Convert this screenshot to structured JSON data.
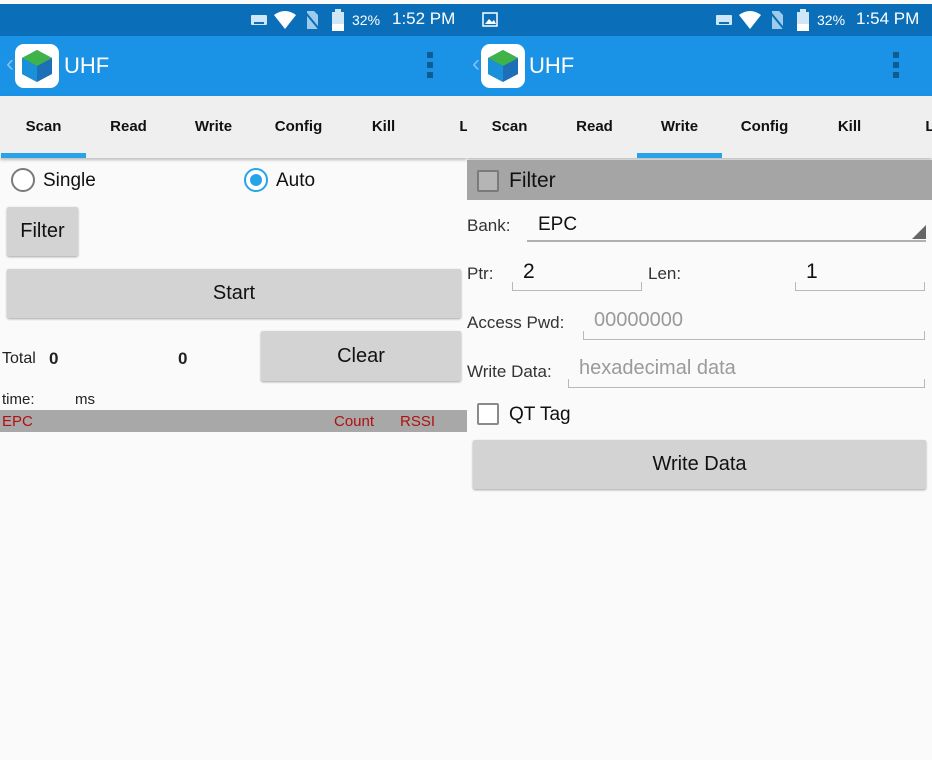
{
  "left": {
    "status": {
      "battery": "32%",
      "time": "1:52 PM"
    },
    "app": {
      "title": "UHF"
    },
    "tabs": [
      "Scan",
      "Read",
      "Write",
      "Config",
      "Kill",
      "Lo"
    ],
    "mode": {
      "single": "Single",
      "auto": "Auto",
      "selected": "auto"
    },
    "filter_button": "Filter",
    "start_button": "Start",
    "total_label": "Total",
    "total_value": "0",
    "count_value": "0",
    "clear_button": "Clear",
    "time_label": "time:",
    "time_unit": "ms",
    "table_headers": {
      "epc": "EPC",
      "count": "Count",
      "rssi": "RSSI"
    }
  },
  "right": {
    "status": {
      "battery": "32%",
      "time": "1:54 PM"
    },
    "app": {
      "title": "UHF"
    },
    "tabs": [
      "Scan",
      "Read",
      "Write",
      "Config",
      "Kill",
      "Lo"
    ],
    "filter_label": "Filter",
    "bank": {
      "label": "Bank:",
      "value": "EPC"
    },
    "ptr": {
      "label": "Ptr:",
      "value": "2"
    },
    "len": {
      "label": "Len:",
      "value": "1"
    },
    "access_pwd": {
      "label": "Access Pwd:",
      "placeholder": "00000000"
    },
    "write_data": {
      "label": "Write Data:",
      "placeholder": "hexadecimal data"
    },
    "qt_tag": {
      "label": "QT Tag",
      "checked": false
    },
    "write_button": "Write Data"
  },
  "colors": {
    "appbar": "#1a92e6",
    "statusbar": "#0a6fb8",
    "tab_indicator": "#29a3e8",
    "header_text": "#b01010"
  },
  "icons": [
    "keyboard-icon",
    "wifi-icon",
    "no-sim-icon",
    "battery-icon",
    "image-icon",
    "app-logo-icon",
    "back-chevron-icon",
    "overflow-menu-icon",
    "dropdown-arrow-icon"
  ]
}
